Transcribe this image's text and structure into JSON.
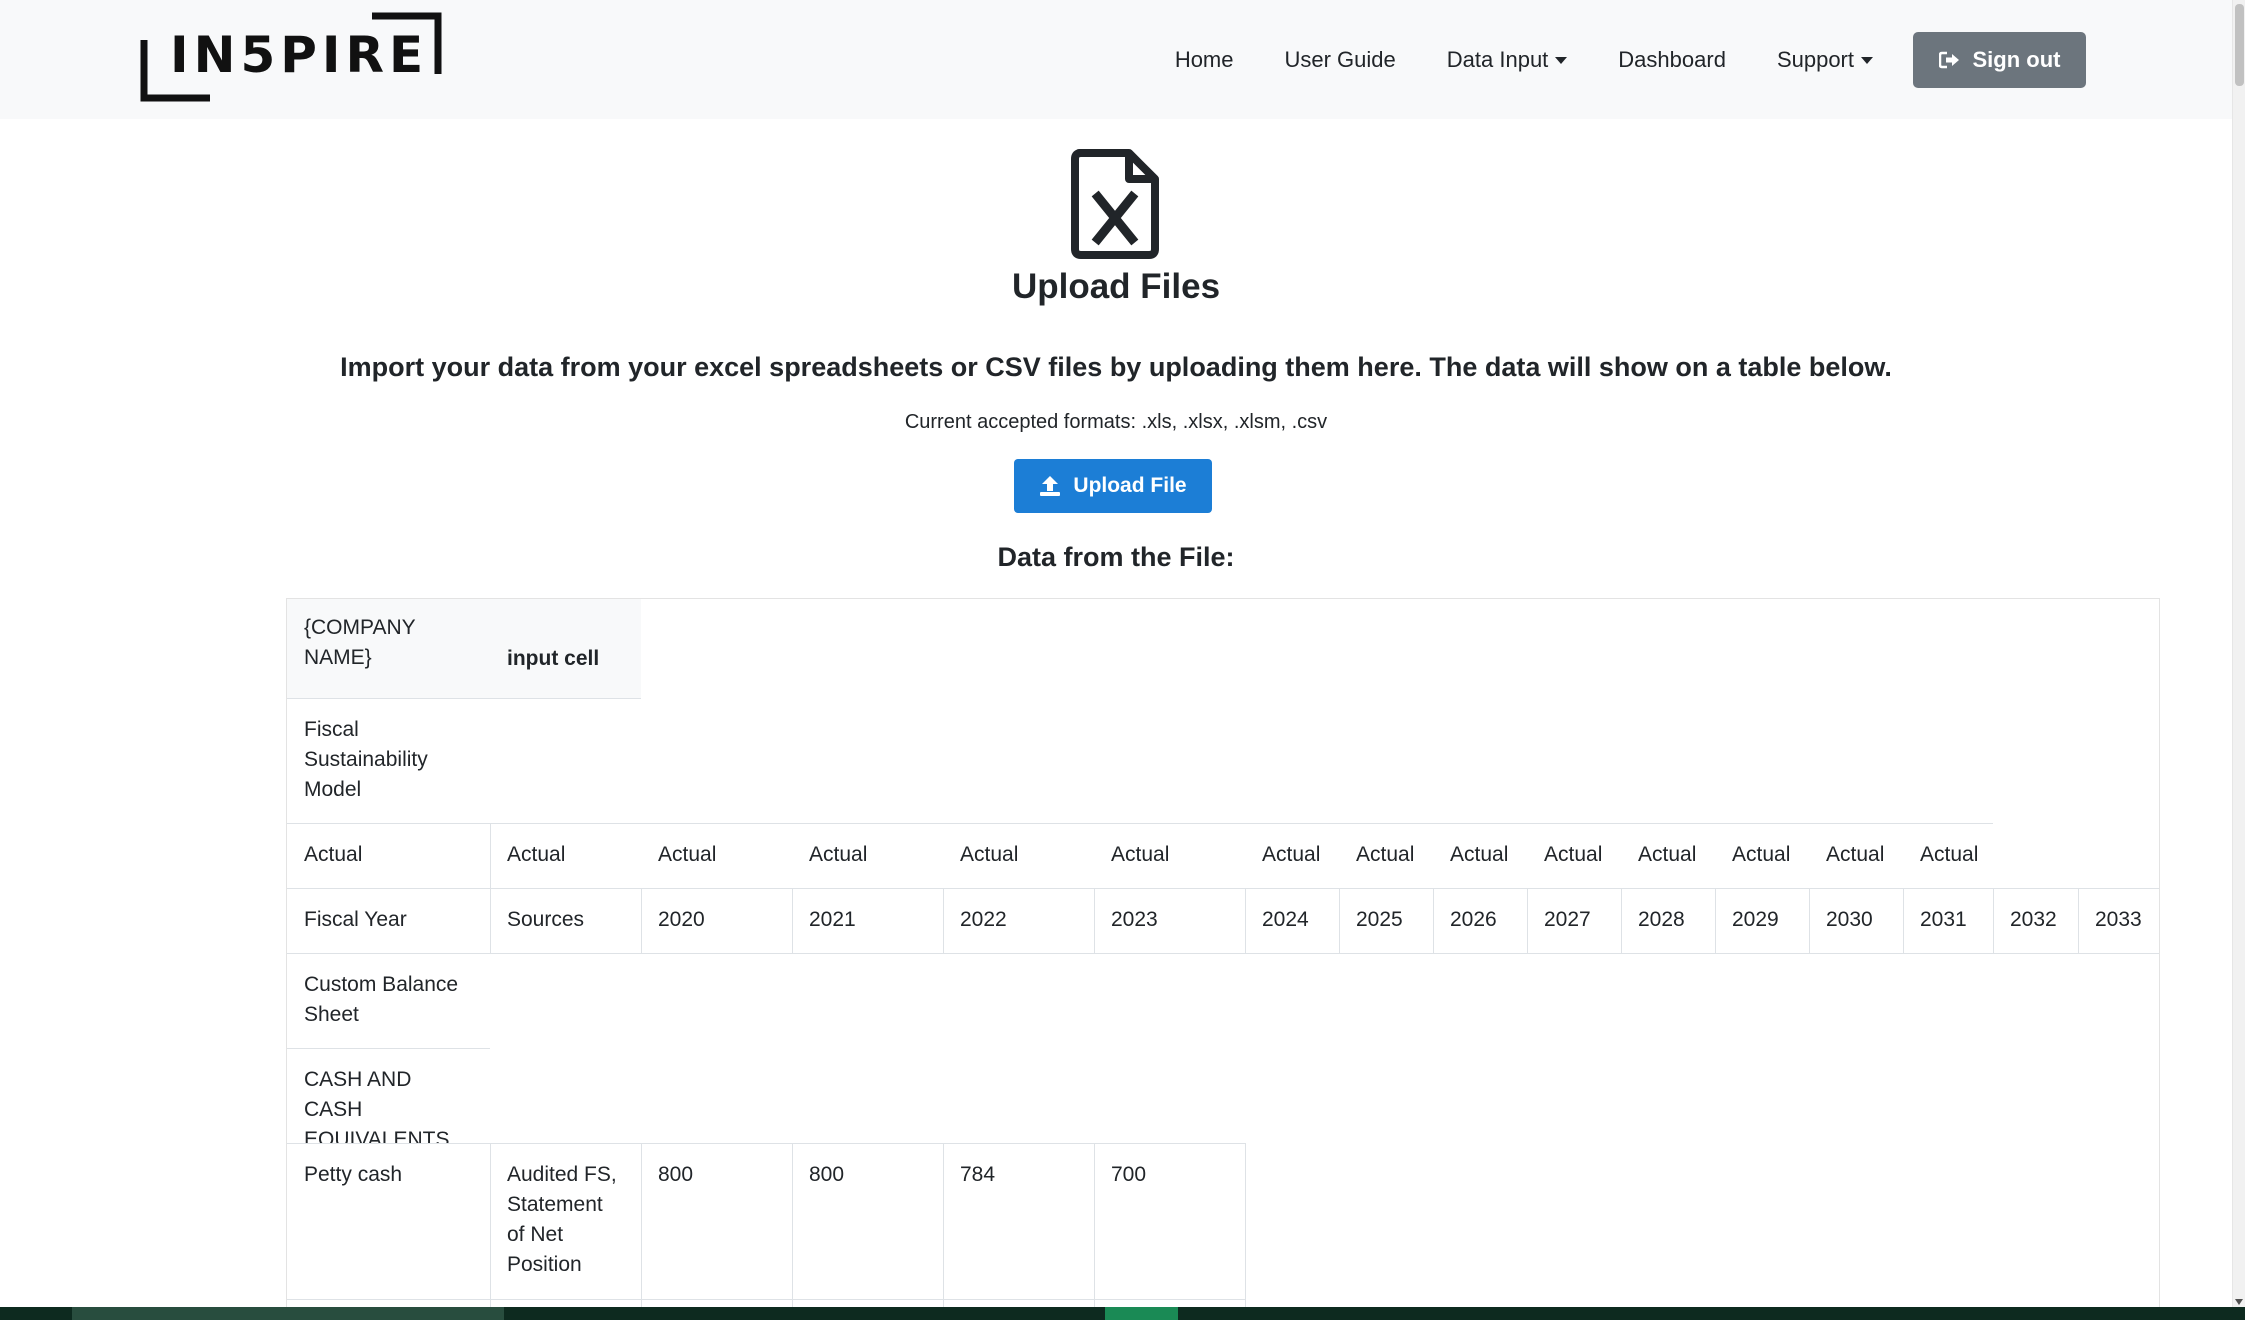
{
  "brand": {
    "logo_text": "IN5PIRE"
  },
  "nav": {
    "home": "Home",
    "user_guide": "User Guide",
    "data_input": "Data Input",
    "dashboard": "Dashboard",
    "support": "Support",
    "sign_out": "Sign out"
  },
  "upload": {
    "title": "Upload Files",
    "lead": "Import your data from your excel spreadsheets or CSV files by uploading them here. The data will show on a table below.",
    "formats": "Current accepted formats: .xls, .xlsx, .xlsm, .csv",
    "button": "Upload File",
    "data_title": "Data from the File:"
  },
  "table": {
    "company_name": "{COMPANY NAME}",
    "input_cell": "input cell",
    "model_title": "Fiscal Sustainability Model",
    "actual_row": [
      "Actual",
      "Actual",
      "Actual",
      "Actual",
      "Actual",
      "Actual",
      "Actual",
      "Actual",
      "Actual",
      "Actual",
      "Actual",
      "Actual",
      "Actual",
      "Actual"
    ],
    "year_row": [
      "Fiscal Year",
      "Sources",
      "2020",
      "2021",
      "2022",
      "2023",
      "2024",
      "2025",
      "2026",
      "2027",
      "2028",
      "2029",
      "2030",
      "2031",
      "2032",
      "2033"
    ],
    "custom_balance_sheet": "Custom Balance Sheet",
    "cash_header": "CASH AND CASH EQUIVALENTS",
    "petty_cash_row": [
      "Petty cash",
      "Audited FS, Statement of Net Position",
      "800",
      "800",
      "784",
      "700"
    ]
  },
  "colors": {
    "navbar_bg": "#f8f9fa",
    "upload_button": "#1c7ed6",
    "signout_button": "#6c757d"
  },
  "icons": [
    "excel-file-icon",
    "upload-icon",
    "sign-out-icon",
    "caret-down-icon"
  ]
}
